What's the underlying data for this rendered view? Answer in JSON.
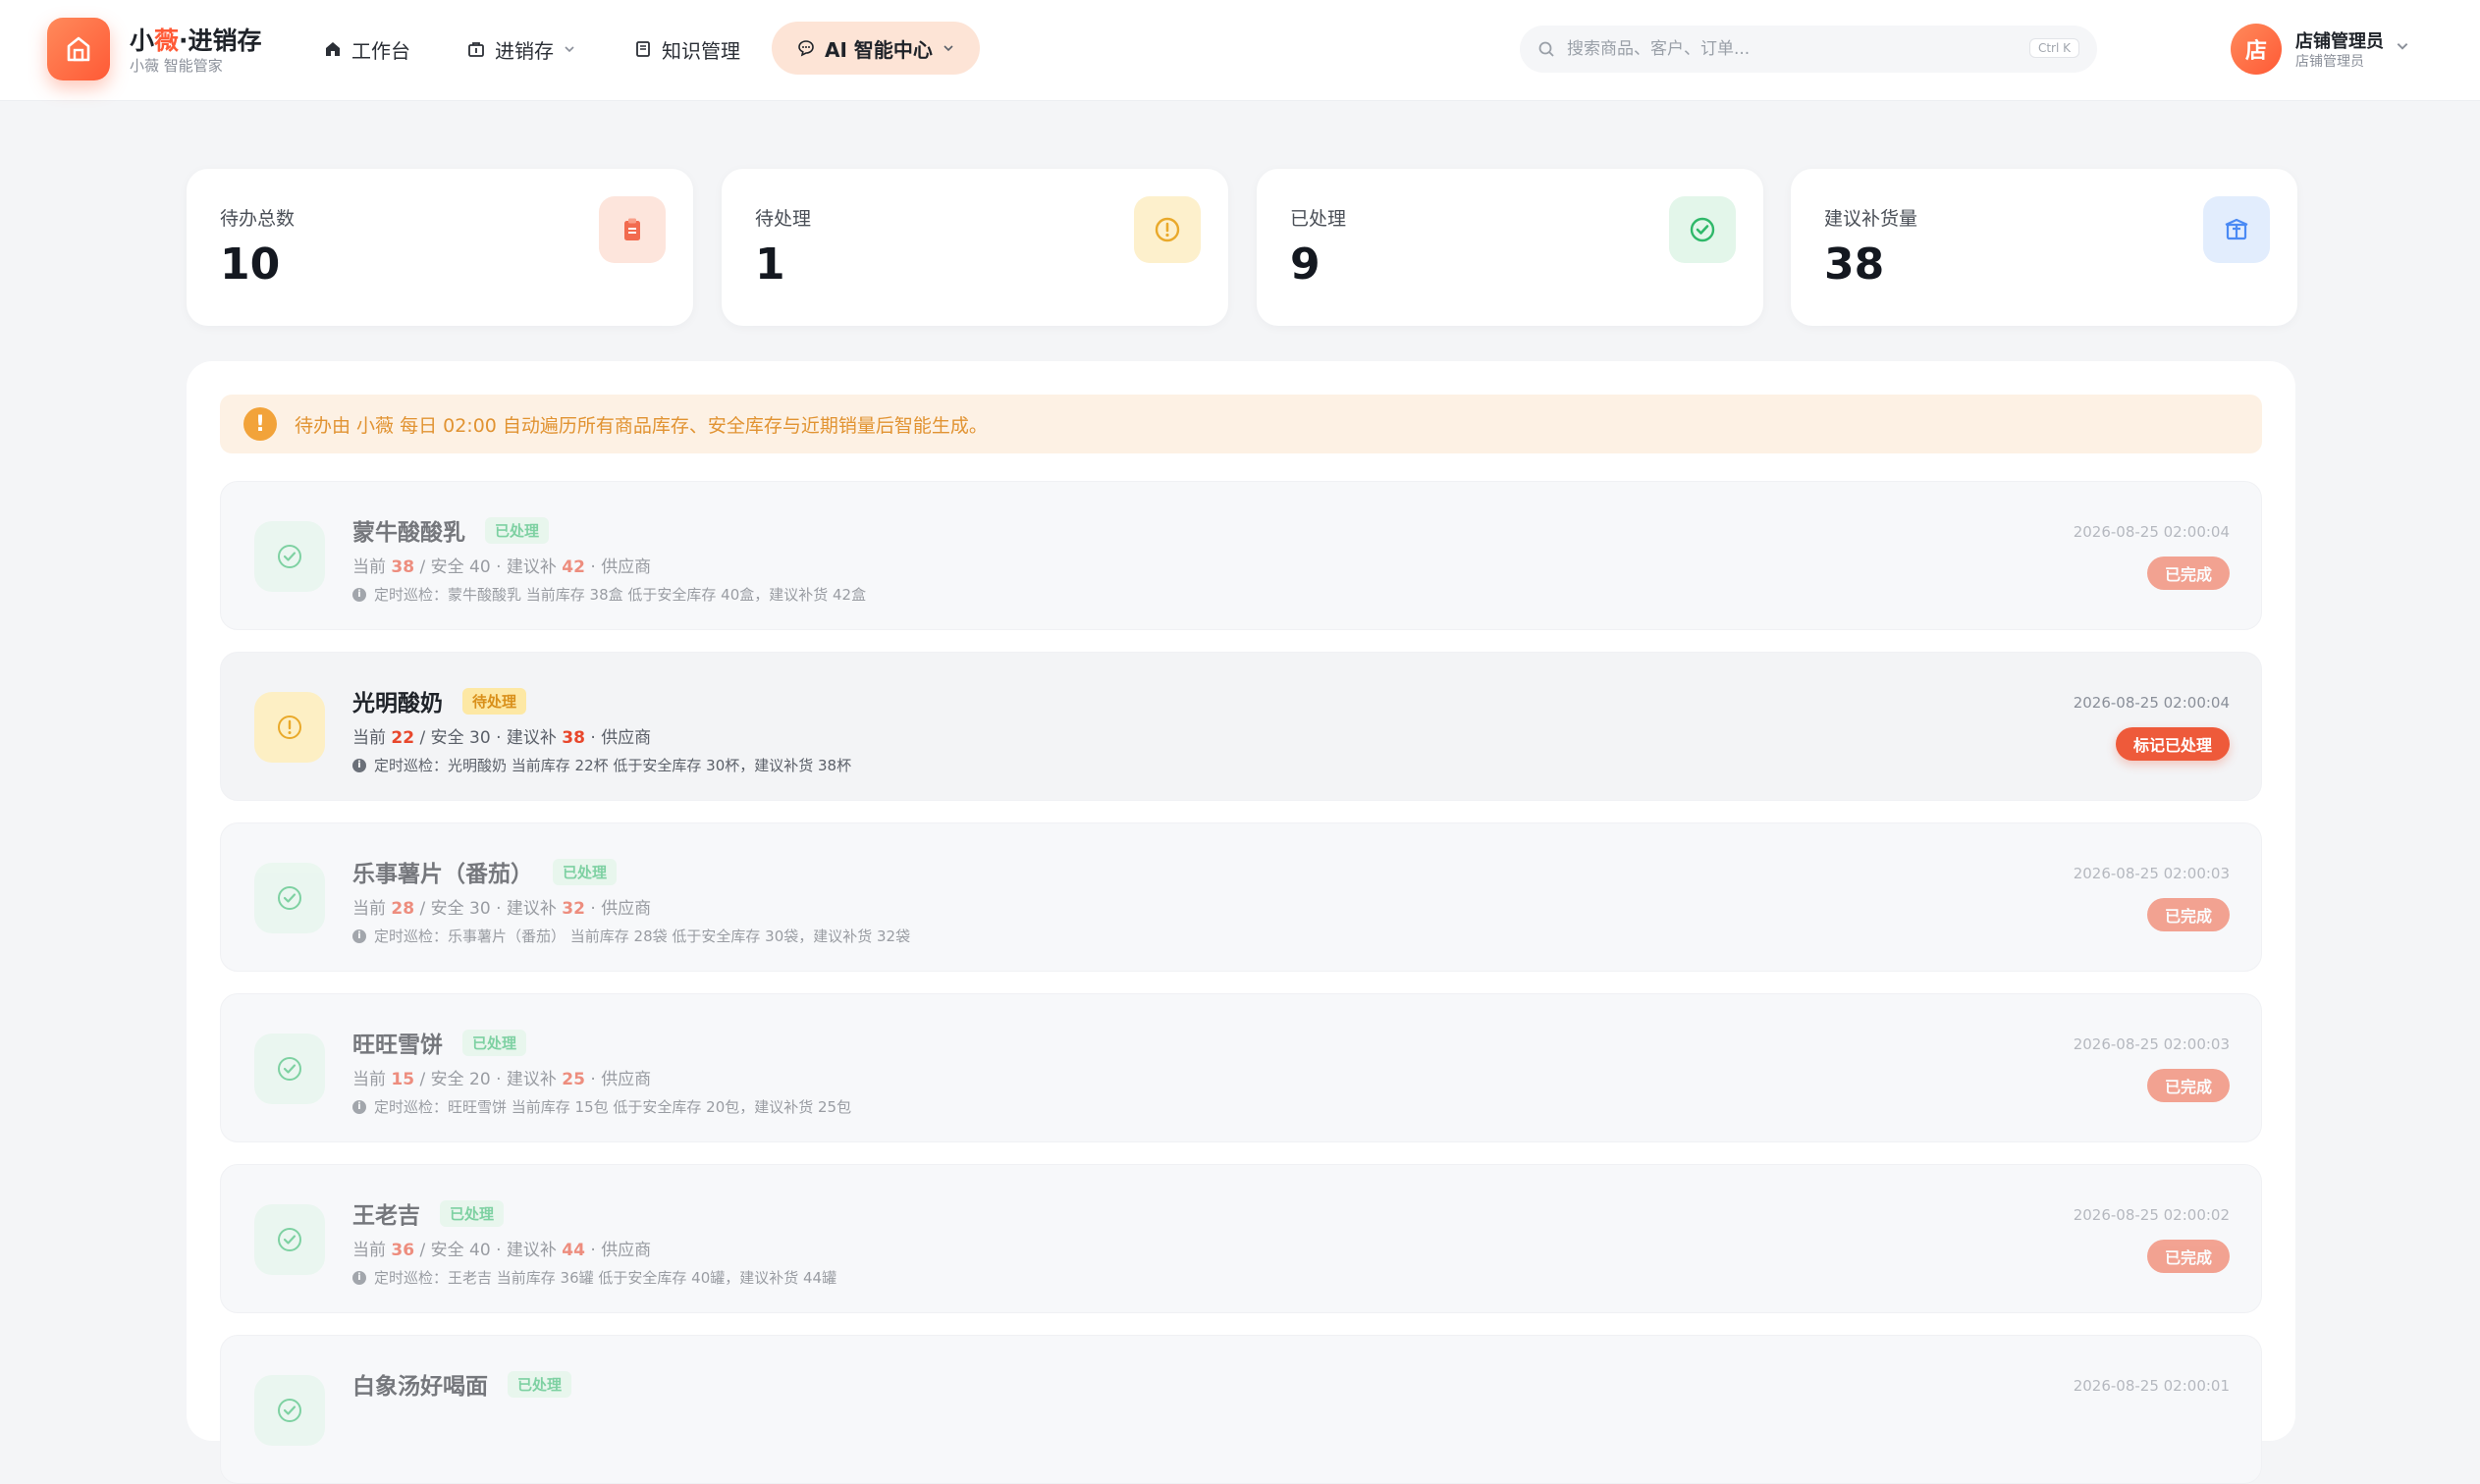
{
  "brand": {
    "name_part1": "小",
    "name_accent": "薇",
    "name_part2": "·进销存",
    "subtitle": "小薇 智能管家"
  },
  "nav": [
    {
      "label": "工作台",
      "icon": "home-icon"
    },
    {
      "label": "进销存",
      "icon": "store-icon",
      "has_dropdown": true
    },
    {
      "label": "知识管理",
      "icon": "book-icon"
    },
    {
      "label": "AI 智能中心",
      "icon": "chat-icon",
      "has_dropdown": true,
      "active": true
    }
  ],
  "search": {
    "placeholder": "搜索商品、客户、订单...",
    "shortcut": "Ctrl K"
  },
  "user": {
    "avatar_char": "店",
    "name": "店铺管理员",
    "role": "店铺管理员"
  },
  "stats": [
    {
      "label": "待办总数",
      "value": "10",
      "icon": "clipboard-icon",
      "color": "#f26b4f"
    },
    {
      "label": "待处理",
      "value": "1",
      "icon": "alert-circle-icon",
      "color": "#e9a92a"
    },
    {
      "label": "已处理",
      "value": "9",
      "icon": "check-circle-icon",
      "color": "#2fb869"
    },
    {
      "label": "建议补货量",
      "value": "38",
      "icon": "box-icon",
      "color": "#4a8af4"
    }
  ],
  "notice": {
    "text": "待办由 小薇 每日 02:00 自动遍历所有商品库存、安全库存与近期销量后智能生成。"
  },
  "labels": {
    "current": "当前",
    "safe": "安全",
    "suggest": "建议补",
    "supplier": "供应商"
  },
  "tasks": [
    {
      "name": "蒙牛酸酸乳",
      "status": "已处理",
      "status_type": "done",
      "current": "38",
      "safe": "40",
      "suggest": "42",
      "note": "定时巡检：蒙牛酸酸乳 当前库存 38盒 低于安全库存 40盒，建议补货 42盒",
      "time": "2026-08-25 02:00:04",
      "action": "已完成"
    },
    {
      "name": "光明酸奶",
      "status": "待处理",
      "status_type": "pending",
      "current": "22",
      "safe": "30",
      "suggest": "38",
      "note": "定时巡检：光明酸奶 当前库存 22杯 低于安全库存 30杯，建议补货 38杯",
      "time": "2026-08-25 02:00:04",
      "action": "标记已处理"
    },
    {
      "name": "乐事薯片（番茄）",
      "status": "已处理",
      "status_type": "done",
      "current": "28",
      "safe": "30",
      "suggest": "32",
      "note": "定时巡检：乐事薯片（番茄） 当前库存 28袋 低于安全库存 30袋，建议补货 32袋",
      "time": "2026-08-25 02:00:03",
      "action": "已完成"
    },
    {
      "name": "旺旺雪饼",
      "status": "已处理",
      "status_type": "done",
      "current": "15",
      "safe": "20",
      "suggest": "25",
      "note": "定时巡检：旺旺雪饼 当前库存 15包 低于安全库存 20包，建议补货 25包",
      "time": "2026-08-25 02:00:03",
      "action": "已完成"
    },
    {
      "name": "王老吉",
      "status": "已处理",
      "status_type": "done",
      "current": "36",
      "safe": "40",
      "suggest": "44",
      "note": "定时巡检：王老吉 当前库存 36罐 低于安全库存 40罐，建议补货 44罐",
      "time": "2026-08-25 02:00:02",
      "action": "已完成"
    },
    {
      "name": "白象汤好喝面",
      "status": "已处理",
      "status_type": "done",
      "current": "",
      "safe": "",
      "suggest": "",
      "note": "",
      "time": "2026-08-25 02:00:01",
      "action": ""
    }
  ]
}
